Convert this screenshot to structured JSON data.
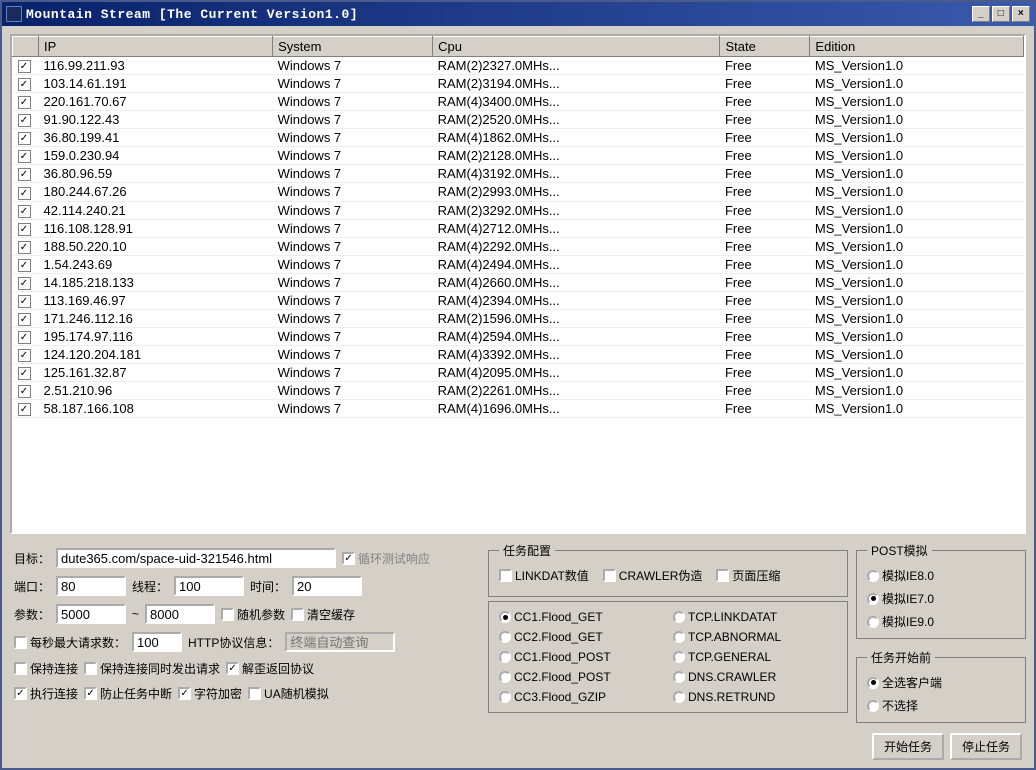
{
  "title": "Mountain Stream [The Current Version1.0]",
  "columns": [
    "IP",
    "System",
    "Cpu",
    "State",
    "Edition"
  ],
  "rows": [
    {
      "ip": "116.99.211.93",
      "system": "Windows 7",
      "cpu": "RAM(2)2327.0MHs...",
      "state": "Free",
      "edition": "MS_Version1.0"
    },
    {
      "ip": "103.14.61.191",
      "system": "Windows 7",
      "cpu": "RAM(2)3194.0MHs...",
      "state": "Free",
      "edition": "MS_Version1.0"
    },
    {
      "ip": "220.161.70.67",
      "system": "Windows 7",
      "cpu": "RAM(4)3400.0MHs...",
      "state": "Free",
      "edition": "MS_Version1.0"
    },
    {
      "ip": "91.90.122.43",
      "system": "Windows 7",
      "cpu": "RAM(2)2520.0MHs...",
      "state": "Free",
      "edition": "MS_Version1.0"
    },
    {
      "ip": "36.80.199.41",
      "system": "Windows 7",
      "cpu": "RAM(4)1862.0MHs...",
      "state": "Free",
      "edition": "MS_Version1.0"
    },
    {
      "ip": "159.0.230.94",
      "system": "Windows 7",
      "cpu": "RAM(2)2128.0MHs...",
      "state": "Free",
      "edition": "MS_Version1.0"
    },
    {
      "ip": "36.80.96.59",
      "system": "Windows 7",
      "cpu": "RAM(4)3192.0MHs...",
      "state": "Free",
      "edition": "MS_Version1.0"
    },
    {
      "ip": "180.244.67.26",
      "system": "Windows 7",
      "cpu": "RAM(2)2993.0MHs...",
      "state": "Free",
      "edition": "MS_Version1.0"
    },
    {
      "ip": "42.114.240.21",
      "system": "Windows 7",
      "cpu": "RAM(2)3292.0MHs...",
      "state": "Free",
      "edition": "MS_Version1.0"
    },
    {
      "ip": "116.108.128.91",
      "system": "Windows 7",
      "cpu": "RAM(4)2712.0MHs...",
      "state": "Free",
      "edition": "MS_Version1.0"
    },
    {
      "ip": "188.50.220.10",
      "system": "Windows 7",
      "cpu": "RAM(4)2292.0MHs...",
      "state": "Free",
      "edition": "MS_Version1.0"
    },
    {
      "ip": "1.54.243.69",
      "system": "Windows 7",
      "cpu": "RAM(4)2494.0MHs...",
      "state": "Free",
      "edition": "MS_Version1.0"
    },
    {
      "ip": "14.185.218.133",
      "system": "Windows 7",
      "cpu": "RAM(4)2660.0MHs...",
      "state": "Free",
      "edition": "MS_Version1.0"
    },
    {
      "ip": "113.169.46.97",
      "system": "Windows 7",
      "cpu": "RAM(4)2394.0MHs...",
      "state": "Free",
      "edition": "MS_Version1.0"
    },
    {
      "ip": "171.246.112.16",
      "system": "Windows 7",
      "cpu": "RAM(2)1596.0MHs...",
      "state": "Free",
      "edition": "MS_Version1.0"
    },
    {
      "ip": "195.174.97.116",
      "system": "Windows 7",
      "cpu": "RAM(4)2594.0MHs...",
      "state": "Free",
      "edition": "MS_Version1.0"
    },
    {
      "ip": "124.120.204.181",
      "system": "Windows 7",
      "cpu": "RAM(4)3392.0MHs...",
      "state": "Free",
      "edition": "MS_Version1.0"
    },
    {
      "ip": "125.161.32.87",
      "system": "Windows 7",
      "cpu": "RAM(4)2095.0MHs...",
      "state": "Free",
      "edition": "MS_Version1.0"
    },
    {
      "ip": "2.51.210.96",
      "system": "Windows 7",
      "cpu": "RAM(2)2261.0MHs...",
      "state": "Free",
      "edition": "MS_Version1.0"
    },
    {
      "ip": "58.187.166.108",
      "system": "Windows 7",
      "cpu": "RAM(4)1696.0MHs...",
      "state": "Free",
      "edition": "MS_Version1.0"
    }
  ],
  "form": {
    "target_label": "目标：",
    "target_value": "dute365.com/space-uid-321546.html",
    "loop_test_response": "循环测试响应",
    "port_label": "端口：",
    "port_value": "80",
    "threads_label": "线程：",
    "threads_value": "100",
    "time_label": "时间：",
    "time_value": "20",
    "params_label": "参数：",
    "param_lo": "5000",
    "param_sep": "~",
    "param_hi": "8000",
    "random_params": "随机参数",
    "clear_cache": "清空缓存",
    "max_req_sec_label": "每秒最大请求数：",
    "max_req_sec_value": "100",
    "http_info_label": "HTTP协议信息：",
    "http_info_placeholder": "终端自动查询",
    "keep_conn": "保持连接",
    "keep_conn_send": "保持连接同时发出请求",
    "parse_response": "解歪返回协议",
    "exec_conn": "执行连接",
    "prevent_interrupt": "防止任务中断",
    "char_encrypt": "字符加密",
    "ua_random": "UA随机模拟"
  },
  "task_config": {
    "legend": "任务配置",
    "linkdat": "LINKDAT数值",
    "crawler": "CRAWLER伪造",
    "page_compress": "页面压缩",
    "cc1_get": "CC1.Flood_GET",
    "cc2_get": "CC2.Flood_GET",
    "cc1_post": "CC1.Flood_POST",
    "cc2_post": "CC2.Flood_POST",
    "cc3_gzip": "CC3.Flood_GZIP",
    "tcp_linkdat": "TCP.LINKDATAT",
    "tcp_abnormal": "TCP.ABNORMAL",
    "tcp_general": "TCP.GENERAL",
    "dns_crawler": "DNS.CRAWLER",
    "dns_retrund": "DNS.RETRUND"
  },
  "post_sim": {
    "legend": "POST模拟",
    "ie8": "模拟IE8.0",
    "ie7": "模拟IE7.0",
    "ie9": "模拟IE9.0"
  },
  "before_task": {
    "legend": "任务开始前",
    "select_all": "全选客户端",
    "no_select": "不选择"
  },
  "buttons": {
    "start": "开始任务",
    "stop": "停止任务"
  }
}
